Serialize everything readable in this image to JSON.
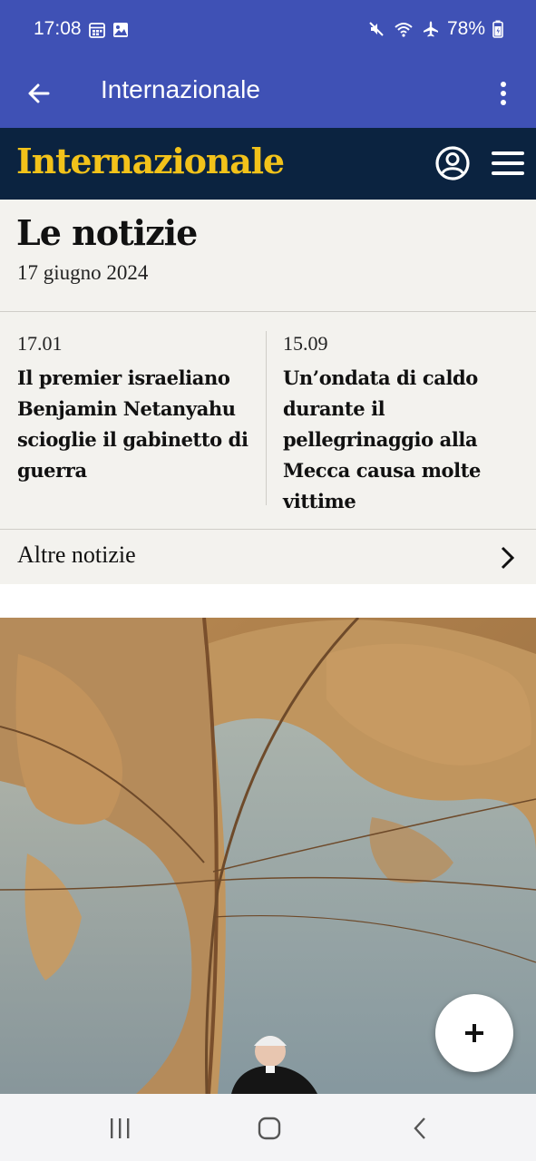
{
  "status_bar": {
    "time": "17:08",
    "battery": "78%",
    "icons": [
      "calendar-icon",
      "gallery-icon",
      "mute-icon",
      "wifi-icon",
      "airplane-icon",
      "battery-icon"
    ]
  },
  "app_bar": {
    "title": "Internazionale",
    "back_icon": "arrow-left-icon",
    "menu_icon": "more-vertical-icon",
    "background": "#3f51b5"
  },
  "site_header": {
    "logo_text": "Internazionale",
    "logo_color": "#f2c21a",
    "background": "#0b2340",
    "profile_icon": "user-circle-icon",
    "menu_icon": "hamburger-menu-icon"
  },
  "news": {
    "title": "Le notizie",
    "date": "17 giugno 2024",
    "articles": [
      {
        "time": "17.01",
        "headline": "Il premier israeliano Benjamin Netanyahu scioglie il gabinetto di guerra"
      },
      {
        "time": "15.09",
        "headline": "Un’ondata di caldo durante il pellegrinaggio alla Mecca causa molte vittime"
      }
    ],
    "more_label": "Altre notizie",
    "background": "#f3f2ee"
  },
  "photo": {
    "subject": "clergyman-in-front-of-world-map-fresco"
  },
  "fab": {
    "icon": "plus-icon"
  },
  "nav_bar": {
    "icons": [
      "recent-apps-icon",
      "home-icon",
      "back-icon"
    ]
  }
}
